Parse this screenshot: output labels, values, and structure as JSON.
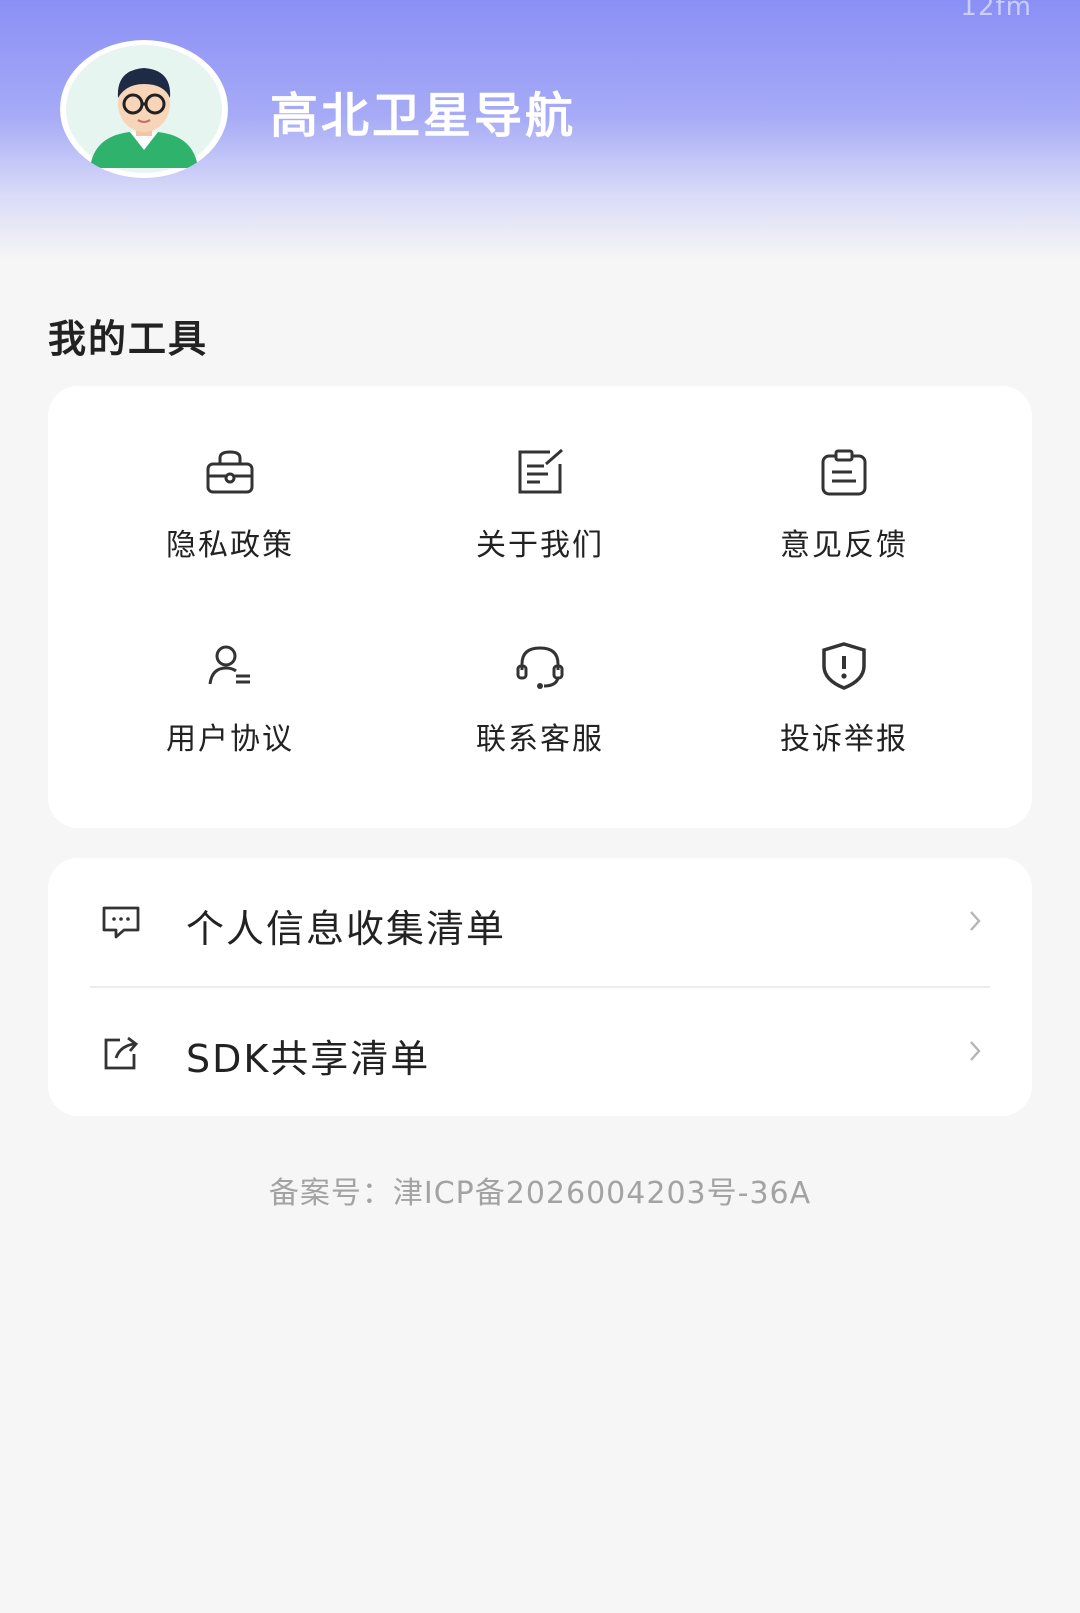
{
  "status": {
    "corner_text": "12fm"
  },
  "header": {
    "app_name": "高北卫星导航",
    "avatar_icon": "avatar-man-glasses"
  },
  "tools": {
    "title": "我的工具",
    "items": [
      {
        "label": "隐私政策",
        "icon": "lock-briefcase-icon"
      },
      {
        "label": "关于我们",
        "icon": "edit-document-icon"
      },
      {
        "label": "意见反馈",
        "icon": "clipboard-icon"
      },
      {
        "label": "用户协议",
        "icon": "user-agreement-icon"
      },
      {
        "label": "联系客服",
        "icon": "headset-icon"
      },
      {
        "label": "投诉举报",
        "icon": "shield-alert-icon"
      }
    ]
  },
  "list": {
    "items": [
      {
        "label": "个人信息收集清单",
        "icon": "chat-bubble-icon"
      },
      {
        "label": "SDK共享清单",
        "icon": "share-icon"
      }
    ]
  },
  "footer": {
    "icp": "备案号：津ICP备2026004203号-36A"
  },
  "colors": {
    "header_gradient_top": "#8a8ff6",
    "background": "#f6f6f6",
    "card": "#ffffff"
  }
}
